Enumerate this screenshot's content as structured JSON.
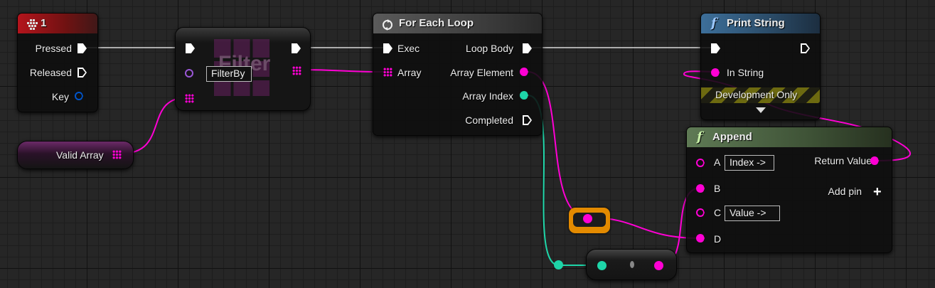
{
  "colors": {
    "exec": "#ffffff",
    "string": "#ff00d4",
    "integer": "#1ed5a8",
    "struct": "#0055cc",
    "delegate": "#9a57d6"
  },
  "nodes": {
    "key_event": {
      "title": "1",
      "icon": "keyboard-icon",
      "pins": {
        "pressed": "Pressed",
        "released": "Released",
        "key": "Key"
      }
    },
    "filter": {
      "watermark": "Filter",
      "filter_by_value": "FilterBy"
    },
    "valid_array": {
      "label": "Valid Array"
    },
    "for_each_loop": {
      "title": "For Each Loop",
      "icon": "loop-icon",
      "pins": {
        "exec": "Exec",
        "array": "Array",
        "loop_body": "Loop Body",
        "array_element": "Array Element",
        "array_index": "Array Index",
        "completed": "Completed"
      }
    },
    "print_string": {
      "title": "Print String",
      "icon": "function-icon",
      "pins": {
        "in_string": "In String"
      },
      "dev_banner": "Development Only"
    },
    "append": {
      "title": "Append",
      "icon": "function-icon",
      "pins": {
        "a": "A",
        "a_value": "Index ->",
        "b": "B",
        "c": "C",
        "c_value": "Value ->",
        "d": "D",
        "return_value": "Return Value",
        "add_pin": "Add pin"
      }
    }
  }
}
